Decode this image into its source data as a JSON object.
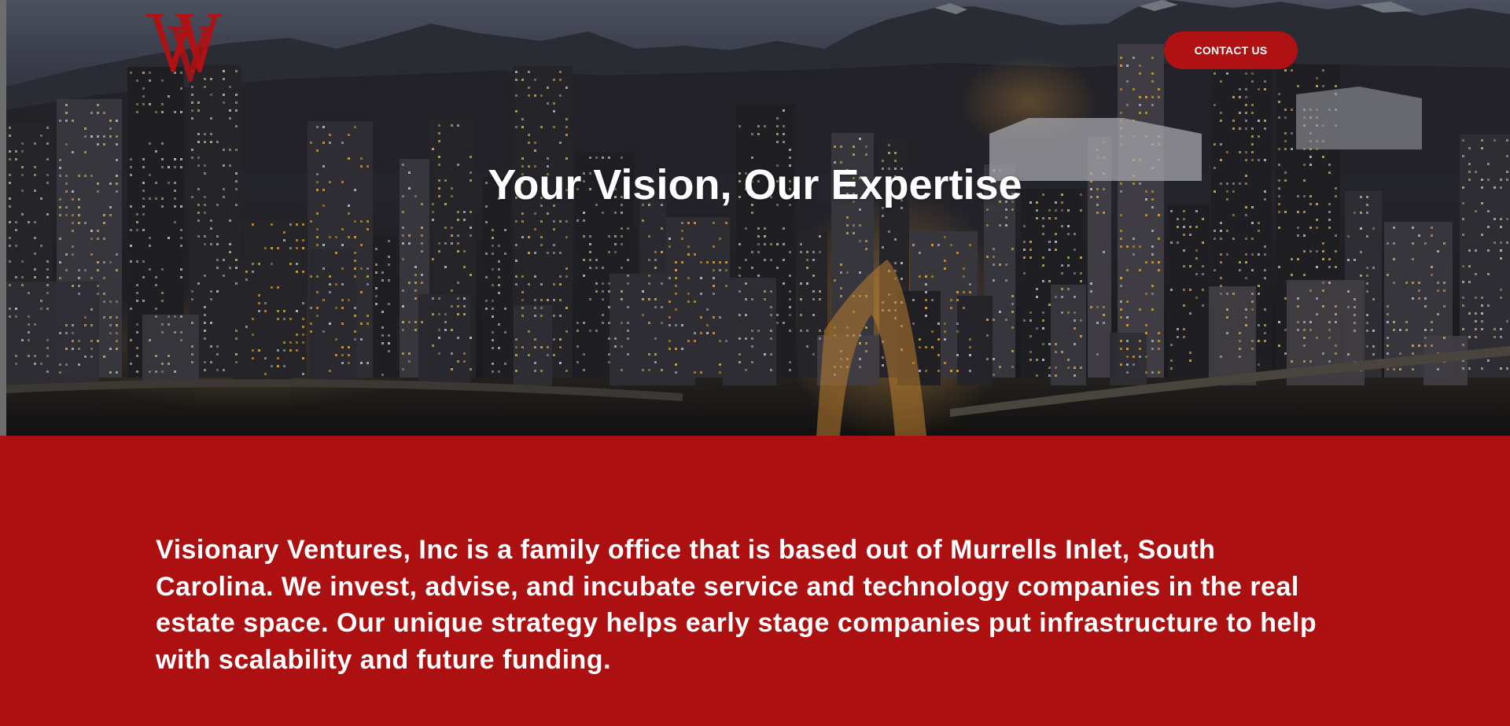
{
  "header": {
    "logo_letters": "VW",
    "contact_button_label": "CONTACT US"
  },
  "hero": {
    "title": "Your Vision, Our Expertise"
  },
  "about": {
    "description": "Visionary Ventures, Inc is a family office that is based out of Murrells Inlet, South Carolina. We invest, advise, and incubate service and technology companies in the real estate space. Our unique strategy helps early stage companies put infrastructure to help with scalability and future funding."
  },
  "colors": {
    "brand_red": "#ac1011",
    "button_red": "#b01112",
    "text_white": "#ffffff"
  },
  "icons": {
    "logo": "vw-monogram-logo"
  }
}
